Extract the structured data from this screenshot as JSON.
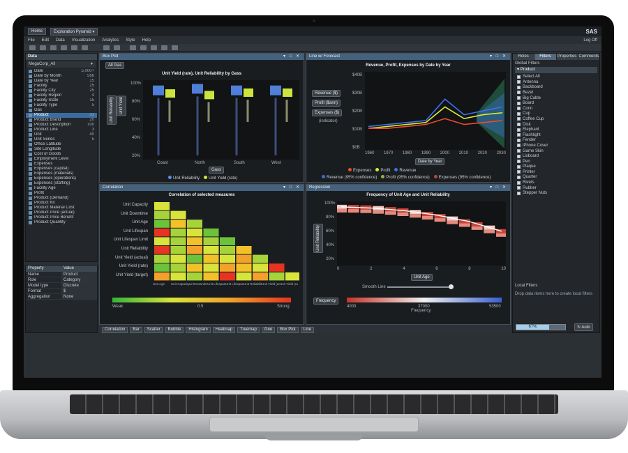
{
  "app": {
    "title_button": "Home",
    "title_dropdown": "Exploration Pyramid",
    "logo": "SAS",
    "menu": [
      "File",
      "Edit",
      "Data",
      "Visualization",
      "Analytics",
      "Style",
      "Help"
    ],
    "menu_right": "Log Off"
  },
  "data_pane": {
    "header": "Data",
    "data_source": "MegaCorp_All",
    "items": [
      {
        "label": "Date",
        "value": "5,000+"
      },
      {
        "label": "Date by Month",
        "value": "566"
      },
      {
        "label": "Date by Year",
        "value": "15"
      },
      {
        "label": "Facility",
        "value": "25"
      },
      {
        "label": "Facility City",
        "value": "25"
      },
      {
        "label": "Facility Region",
        "value": "4"
      },
      {
        "label": "Facility State",
        "value": "15"
      },
      {
        "label": "Facility Type",
        "value": "5"
      },
      {
        "label": "Gas",
        "value": ""
      },
      {
        "label": "Product",
        "value": "31"
      },
      {
        "label": "Product Brand",
        "value": "20"
      },
      {
        "label": "Product Description",
        "value": "100"
      },
      {
        "label": "Product Line",
        "value": "3"
      },
      {
        "label": "Unit",
        "value": "40"
      },
      {
        "label": "Unit Series",
        "value": "5"
      },
      {
        "label": "Office Latitude",
        "value": ""
      },
      {
        "label": "Site Longitude",
        "value": ""
      },
      {
        "label": "Cost of Goods",
        "value": ""
      },
      {
        "label": "Employment Level",
        "value": ""
      },
      {
        "label": "Expenses",
        "value": ""
      },
      {
        "label": "Expenses (capital)",
        "value": ""
      },
      {
        "label": "Expenses (materials)",
        "value": ""
      },
      {
        "label": "Expenses (operations)",
        "value": ""
      },
      {
        "label": "Expenses (staffing)",
        "value": ""
      },
      {
        "label": "Facility Age",
        "value": ""
      },
      {
        "label": "Profit",
        "value": ""
      },
      {
        "label": "Product (Demand)",
        "value": ""
      },
      {
        "label": "Product Kit",
        "value": ""
      },
      {
        "label": "Product Material Cost",
        "value": ""
      },
      {
        "label": "Product Price (actual)",
        "value": ""
      },
      {
        "label": "Product Price Benefit",
        "value": ""
      },
      {
        "label": "Product Quantity",
        "value": ""
      }
    ]
  },
  "properties": {
    "headers": [
      "Property",
      "Value"
    ],
    "rows": [
      [
        "Name",
        "Product"
      ],
      [
        "Role",
        "Category"
      ],
      [
        "Model type",
        "Discrete"
      ],
      [
        "Format",
        "$"
      ],
      [
        "Aggregation",
        "None"
      ]
    ]
  },
  "box_panel": {
    "header": "Box Plot",
    "filter_tab": "All Gas",
    "title": "Unit Yield (rate), Unit Reliability by Gass",
    "side_buttons": [
      "Unit Reliability",
      "Unit Yield"
    ],
    "categories": [
      "Coast",
      "North",
      "South",
      "West"
    ],
    "y_ticks": [
      "100%",
      "80%",
      "60%",
      "40%",
      "20%"
    ],
    "bottom_button": "Gass",
    "legend": [
      "Unit Reliability",
      "Unit Yield (rate)"
    ]
  },
  "line_panel": {
    "header": "Line w/ Forecast",
    "title": "Revenue, Profit, Expenses by Date by Year",
    "side_buttons": [
      "Revenue ($)",
      "Profit ($ann)",
      "Expenses ($)",
      "(indicator)"
    ],
    "y_ticks": [
      "$40B",
      "$30B",
      "$20B",
      "$10B",
      "$0B"
    ],
    "x_ticks": [
      "1960",
      "1970",
      "1980",
      "1990",
      "2000",
      "2010",
      "2020",
      "2030"
    ],
    "bottom_button": "Date by Year",
    "legend1": [
      "Expenses",
      "Profit",
      "Revenue"
    ],
    "legend2": [
      "Revenue (95% confidence)",
      "Profit (95% confidence)",
      "Expenses (95% confidence)"
    ]
  },
  "corr_panel": {
    "header": "Correlation",
    "title": "Correlation of selected measures",
    "row_labels": [
      "Unit Capacity",
      "Unit Downtime",
      "Unit Age",
      "Unit Lifespan",
      "Unit Lifespan Limit",
      "Unit Reliability",
      "Unit Yield (actual)",
      "Unit Yield (rate)",
      "Unit Yield (target)"
    ],
    "col_labels": [
      "Unit Age",
      "Unit Capacity",
      "Unit Downtime",
      "Unit Lifespan",
      "Unit Lifespan Limit",
      "Unit Reliability",
      "Unit Yield (actual)",
      "Unit Yield (rate)"
    ],
    "scale_labels": [
      "Weak",
      "0.5",
      "Strong"
    ]
  },
  "reg_panel": {
    "header": "Regression",
    "title": "Frequency of Unit Age and Unit Reliability",
    "side_button": "Unit Reliability",
    "y_ticks": [
      "100%",
      "80%",
      "60%",
      "40%",
      "20%"
    ],
    "x_ticks": [
      "0",
      "2",
      "4",
      "6",
      "8",
      "10"
    ],
    "bottom_button": "Unit Age",
    "slider_label": "Smooth Line",
    "freq_button": "Frequency",
    "scale_labels": [
      "4000",
      "Frequency",
      "37000",
      "53500"
    ]
  },
  "right_pane": {
    "tabs": [
      "Roles",
      "Filters",
      "Properties",
      "Comments"
    ],
    "section": "Global Filters",
    "filter_name": "Product",
    "select_all": "Select All",
    "items": [
      "Antenna",
      "Backboard",
      "Bezel",
      "Big Cable",
      "Board",
      "Conn",
      "Cup",
      "Coffee Cup",
      "Disk",
      "Elephant",
      "Flashlight",
      "Fender",
      "iPhone Cover",
      "Game Skin",
      "Lisboard",
      "Pen",
      "Plaque",
      "Printer",
      "Quarter",
      "Rivets",
      "Rubber",
      "Stepper Nuts"
    ],
    "local_filters": "Local Filters",
    "drop_hint": "Drop data items here to create local filters",
    "progress_label": "67%",
    "progress_value": 0.67,
    "auto_button": "Auto"
  },
  "bottom_bar": [
    "Correlation",
    "Bar",
    "Scatter",
    "Bubble",
    "Histogram",
    "Heatmap",
    "Treemap",
    "Geo",
    "Box Plot",
    "Line"
  ],
  "colors": {
    "panel_header": "#44627e",
    "revenue": "#3f6ff0",
    "profit": "#d7e93a",
    "expenses": "#ef4a2a",
    "heat_strong": "#e53421",
    "heat_weak": "#35b43a"
  },
  "chart_data": [
    {
      "type": "box",
      "title": "Unit Yield (rate), Unit Reliability by Gass",
      "categories": [
        "Coast",
        "North",
        "South",
        "West"
      ],
      "series": [
        {
          "name": "Unit Reliability",
          "values": [
            0.88,
            0.9,
            0.88,
            0.88
          ]
        },
        {
          "name": "Unit Yield (rate)",
          "values": [
            0.85,
            0.83,
            0.86,
            0.86
          ]
        }
      ]
    },
    {
      "type": "line",
      "title": "Revenue, Profit, Expenses by Date by Year",
      "x": [
        1960,
        1970,
        1980,
        1990,
        2000,
        2010,
        2020,
        2030
      ],
      "series": [
        {
          "name": "Revenue",
          "values": [
            12,
            13,
            14,
            15,
            26,
            18,
            20,
            22
          ]
        },
        {
          "name": "Profit",
          "values": [
            11,
            12,
            13,
            14,
            22,
            16,
            18,
            19
          ]
        },
        {
          "name": "Expenses",
          "values": [
            11,
            11,
            12,
            13,
            16,
            13,
            14,
            15
          ]
        }
      ]
    },
    {
      "type": "heatmap",
      "title": "Correlation of selected measures"
    },
    {
      "type": "line",
      "title": "Frequency of Unit Age and Unit Reliability",
      "x": [
        0,
        2,
        4,
        6,
        8,
        10
      ],
      "values": [
        0.98,
        0.96,
        0.92,
        0.85,
        0.75,
        0.6
      ]
    }
  ]
}
